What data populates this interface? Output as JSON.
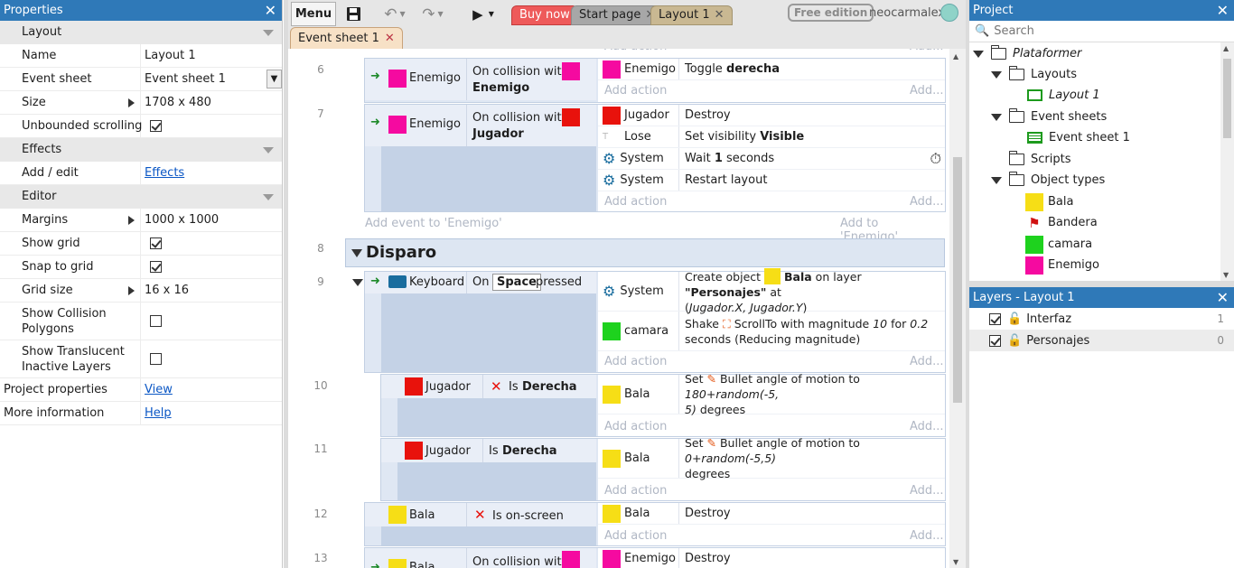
{
  "left": {
    "title": "Properties",
    "sections": {
      "layout": "Layout",
      "effects": "Effects",
      "editor": "Editor"
    },
    "rows": {
      "name": {
        "k": "Name",
        "v": "Layout 1"
      },
      "eventsheet": {
        "k": "Event sheet",
        "v": "Event sheet 1"
      },
      "size": {
        "k": "Size",
        "v": "1708 x 480"
      },
      "unbounded": {
        "k": "Unbounded scrolling",
        "v": true
      },
      "addedit": {
        "k": "Add / edit",
        "v": "Effects"
      },
      "margins": {
        "k": "Margins",
        "v": "1000 x 1000"
      },
      "showgrid": {
        "k": "Show grid",
        "v": true
      },
      "snapgrid": {
        "k": "Snap to grid",
        "v": true
      },
      "gridsize": {
        "k": "Grid size",
        "v": "16 x 16"
      },
      "collision": {
        "k1": "Show Collision",
        "k2": "Polygons",
        "v": false
      },
      "translucent": {
        "k1": "Show Translucent",
        "k2": "Inactive Layers",
        "v": false
      },
      "projprops": {
        "k": "Project properties",
        "v": "View"
      },
      "moreinfo": {
        "k": "More information",
        "v": "Help"
      }
    }
  },
  "toolbar": {
    "menu": "Menu",
    "tabs": {
      "buynow": "Buy now",
      "startpage": "Start page",
      "layout1": "Layout 1"
    },
    "free_edition": "Free edition",
    "username": "neocarmalex",
    "subtab": "Event sheet 1",
    "tab_colors": {
      "buynow": "#ee5a5a",
      "startpage": "#a7a7a7",
      "layout1": "#c9b892",
      "subtab": "#f7e1c6"
    }
  },
  "events": {
    "add_action": "Add action",
    "add_ellipsis": "Add...",
    "add_event_enemigo": "Add event to 'Enemigo'",
    "add_to_enemigo": "Add to 'Enemigo'...",
    "group_title": "Disparo",
    "lines": [
      "6",
      "7",
      "8",
      "9",
      "10",
      "11",
      "12",
      "13"
    ],
    "e6": {
      "cond_obj": "Enemigo",
      "cond_text1": "On collision with",
      "cond_text2": "Enemigo",
      "act_obj": "Enemigo",
      "act_text1": "Toggle ",
      "act_text2": "derecha"
    },
    "e7": {
      "cond_obj": "Enemigo",
      "cond_text1": "On collision with",
      "cond_text2": "Jugador",
      "a1_obj": "Jugador",
      "a1": "Destroy",
      "a2_obj": "Lose",
      "a2a": "Set visibility ",
      "a2b": "Visible",
      "a3_obj": "System",
      "a3a": "Wait ",
      "a3b": "1",
      "a3c": " seconds",
      "a4_obj": "System",
      "a4": "Restart layout"
    },
    "e9": {
      "cond_obj": "Keyboard",
      "cond_on": "On",
      "cond_key": "Space",
      "cond_pressed": "pressed",
      "a1_obj": "System",
      "a1a": "Create object ",
      "a1b": "Bala",
      "a1c": " on layer ",
      "a1d": "\"Personajes\"",
      "a1e": " at",
      "a1f": "(",
      "a1g": "Jugador.X, Jugador.Y",
      "a1h": ")",
      "a2_obj": "camara",
      "a2a": "Shake ",
      "a2b": "ScrollTo with magnitude ",
      "a2c": "10",
      "a2d": " for ",
      "a2e": "0.2",
      "a2f": "seconds (Reducing magnitude)"
    },
    "e10": {
      "cond_obj": "Jugador",
      "cond_text1": "Is ",
      "cond_text2": "Derecha",
      "act_obj": "Bala",
      "act_a": "Set ",
      "act_b": "Bullet angle of motion to ",
      "act_c": "180+random(-5,",
      "act_d": "5)",
      "act_e": " degrees"
    },
    "e11": {
      "cond_obj": "Jugador",
      "cond_text1": "Is ",
      "cond_text2": "Derecha",
      "act_obj": "Bala",
      "act_a": "Set ",
      "act_b": "Bullet angle of motion to ",
      "act_c": "0+random(-5,5)",
      "act_d": "degrees"
    },
    "e12": {
      "cond_obj": "Bala",
      "cond_text": "Is on-screen",
      "act_obj": "Bala",
      "act": "Destroy"
    },
    "e13": {
      "cond_obj": "Bala",
      "cond_text": "On collision with",
      "act_obj": "Enemigo",
      "act": "Destroy"
    },
    "colors": {
      "enemigo": "#f50aa0",
      "jugador": "#e8120c",
      "bala": "#f6de16",
      "camara": "#1ed21e"
    }
  },
  "project": {
    "title": "Project",
    "search_placeholder": "Search",
    "root": "Plataformer",
    "layouts": "Layouts",
    "layout1": "Layout 1",
    "eventsheets": "Event sheets",
    "eventsheet1": "Event sheet 1",
    "scripts": "Scripts",
    "objecttypes": "Object types",
    "objects": [
      "Bala",
      "Bandera",
      "camara",
      "Enemigo"
    ]
  },
  "layers": {
    "title": "Layers - Layout 1",
    "items": [
      {
        "name": "Interfaz",
        "num": "1"
      },
      {
        "name": "Personajes",
        "num": "0"
      }
    ]
  }
}
